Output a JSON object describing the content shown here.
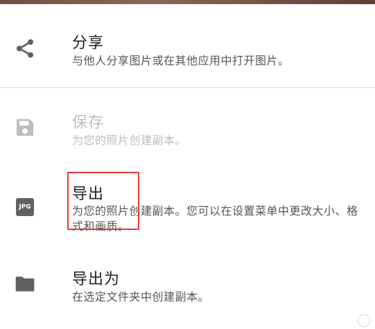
{
  "menu": {
    "share": {
      "icon": "share-icon",
      "title": "分享",
      "description": "与他人分享图片或在其他应用中打开图片。"
    },
    "save": {
      "icon": "save-icon",
      "title": "保存",
      "description": "为您的照片创建副本。",
      "disabled": true
    },
    "export": {
      "icon": "jpg-icon",
      "icon_label": "JPG",
      "title": "导出",
      "description": "为您的照片创建副本。您可以在设置菜单中更改大小、格式和画质。"
    },
    "export_as": {
      "icon": "folder-icon",
      "title": "导出为",
      "description": "在选定文件夹中创建副本。"
    }
  },
  "colors": {
    "icon": "#616161",
    "icon_disabled": "#bdbdbd",
    "highlight": "#e53935",
    "divider": "#e0e0e0"
  }
}
